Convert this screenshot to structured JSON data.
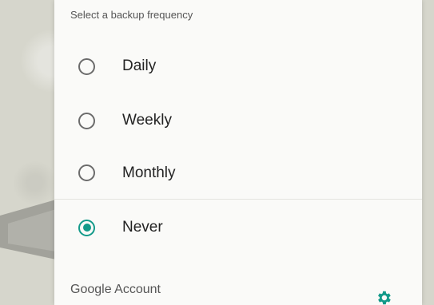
{
  "dialog": {
    "title": "Select a backup frequency",
    "options": [
      {
        "label": "Daily",
        "selected": false
      },
      {
        "label": "Weekly",
        "selected": false
      },
      {
        "label": "Monthly",
        "selected": false
      },
      {
        "label": "Never",
        "selected": true
      }
    ]
  },
  "account": {
    "label": "Google Account",
    "icon": "gear-icon"
  },
  "colors": {
    "accent": "#139a8a",
    "radio_unchecked": "#6b6b6b",
    "panel_bg": "#fafaf8"
  }
}
